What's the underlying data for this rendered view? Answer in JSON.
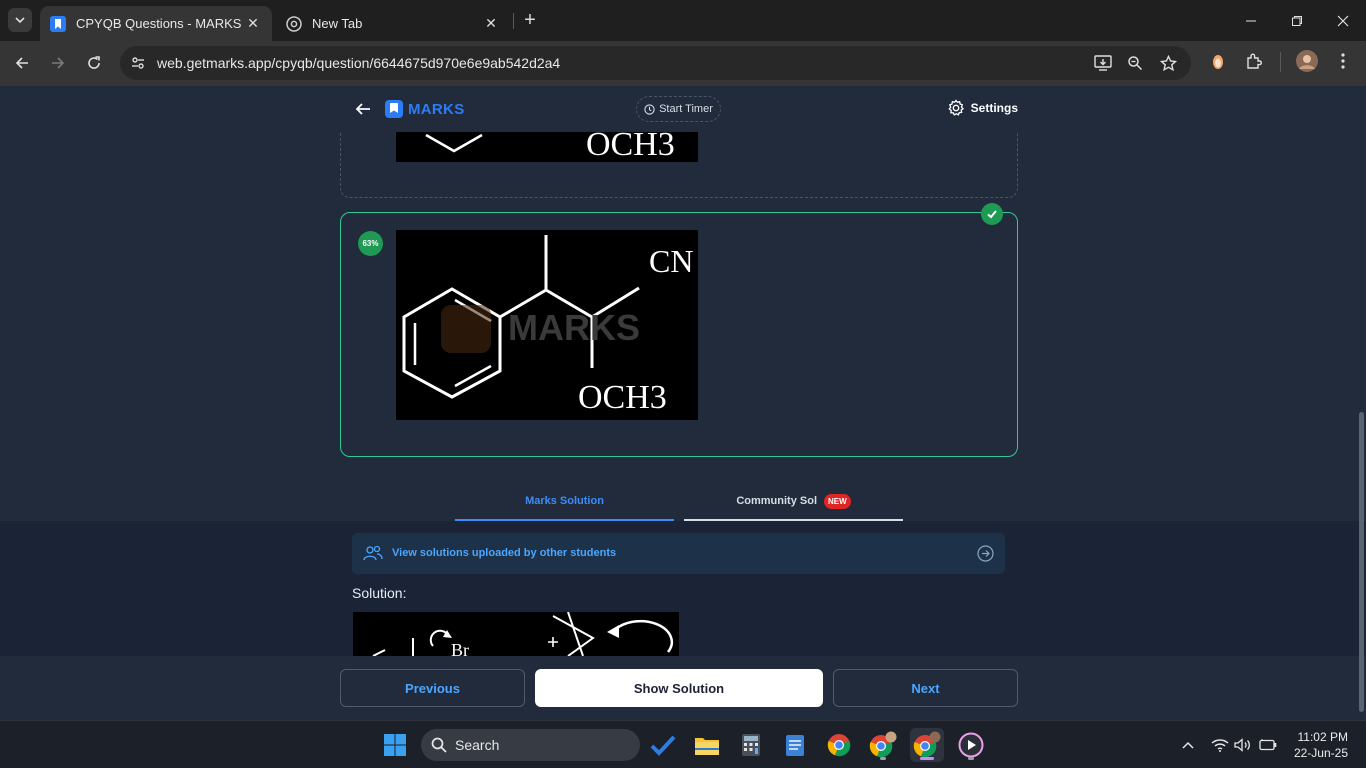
{
  "browser": {
    "tabs": [
      {
        "title": "CPYQB Questions - MARKS App",
        "active": true
      },
      {
        "title": "New Tab",
        "active": false
      }
    ],
    "url": "web.getmarks.app/cpyqb/question/6644675d970e6e9ab542d2a4"
  },
  "app": {
    "brand": "MARKS",
    "timer_label": "Start Timer",
    "settings_label": "Settings"
  },
  "options": {
    "previous_image_label": "OCH3",
    "correct": {
      "percent": "63%",
      "label_cn": "CN",
      "label_och3": "OCH3",
      "watermark": "MARKS"
    }
  },
  "solution_tabs": {
    "marks": "Marks Solution",
    "community": "Community Sol",
    "community_badge": "NEW"
  },
  "community_bar": {
    "text": "View solutions uploaded by other students"
  },
  "solution": {
    "heading": "Solution:",
    "image_text": "Br"
  },
  "footer": {
    "previous": "Previous",
    "show_solution": "Show Solution",
    "next": "Next"
  },
  "taskbar": {
    "search_placeholder": "Search",
    "time": "11:02 PM",
    "date": "22-Jun-25"
  },
  "colors": {
    "accent_blue": "#2c7cf6",
    "correct_green": "#2ec995",
    "badge_green": "#1f9a55",
    "new_red": "#e02525"
  }
}
